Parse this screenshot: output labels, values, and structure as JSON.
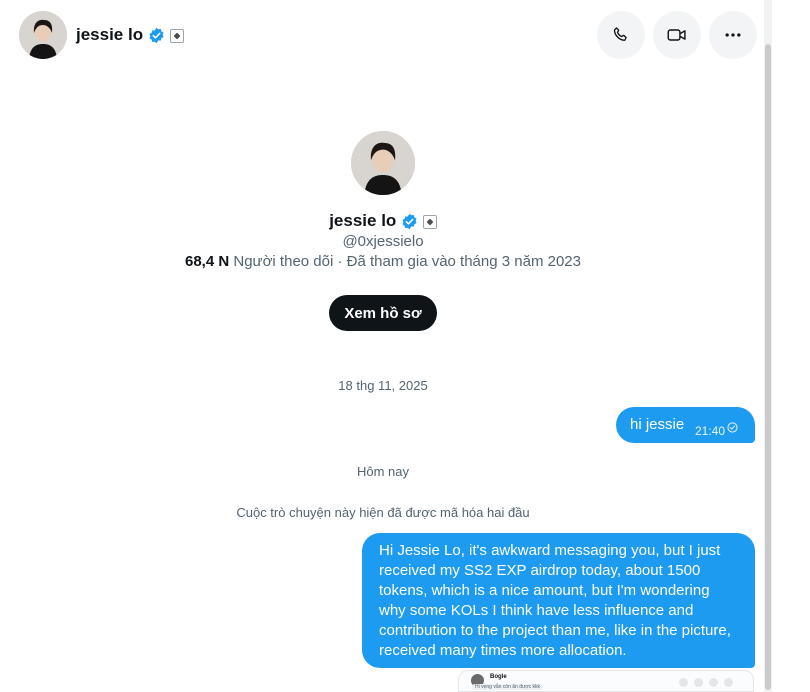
{
  "header": {
    "name": "jessie lo",
    "icons": {
      "verified": "verified-badge-icon",
      "affiliate": "affiliate-badge-icon",
      "call": "phone-icon",
      "video": "video-camera-icon",
      "more": "more-horizontal-icon"
    }
  },
  "profile": {
    "name": "jessie lo",
    "handle": "@0xjessielo",
    "followers_count": "68,4 N",
    "followers_label": "Người theo dõi",
    "separator": " · ",
    "joined": "Đã tham gia vào tháng 3 năm 2023",
    "view_profile_label": "Xem hồ sơ"
  },
  "conversation": {
    "date_1": "18 thg 11, 2025",
    "message_1": {
      "text": "hi jessie",
      "time": "21:40",
      "status_icon": "sent-check-icon"
    },
    "date_2": "Hôm nay",
    "encryption_notice": "Cuộc trò chuyện này hiện đã được mã hóa hai đầu",
    "message_2": {
      "text": "Hi Jessie Lo, it's awkward messaging you, but I just received my SS2 EXP airdrop today, about 1500 tokens, which is a nice amount, but I'm wondering why some KOLs I think have less influence and contribution to the project than me, like in the picture, received many times more allocation."
    },
    "attachment_preview": {
      "name": "Bogle",
      "message": "Hi vẹng vẫn còn ăn được kkk"
    }
  },
  "colors": {
    "accent": "#1d9bf0",
    "text": "#0f1419",
    "secondary": "#536471",
    "button_dark": "#0f1419"
  }
}
